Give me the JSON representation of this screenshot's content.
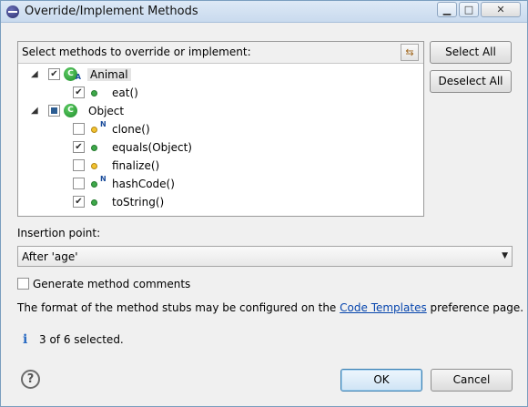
{
  "window": {
    "title": "Override/Implement Methods"
  },
  "panel": {
    "label": "Select methods to override or implement:"
  },
  "tree": {
    "classes": [
      {
        "name": "Animal",
        "state": "checked",
        "abstract": true,
        "selected": true
      },
      {
        "name": "Object",
        "state": "partial",
        "abstract": false,
        "selected": false
      }
    ],
    "methods": [
      {
        "name": "eat()",
        "checked": true,
        "visibility": "public",
        "native": false
      },
      {
        "name": "clone()",
        "checked": false,
        "visibility": "protected",
        "native": true
      },
      {
        "name": "equals(Object)",
        "checked": true,
        "visibility": "public",
        "native": false
      },
      {
        "name": "finalize()",
        "checked": false,
        "visibility": "protected",
        "native": false
      },
      {
        "name": "hashCode()",
        "checked": false,
        "visibility": "public",
        "native": true
      },
      {
        "name": "toString()",
        "checked": true,
        "visibility": "public",
        "native": false
      }
    ],
    "native_marker": "N"
  },
  "buttons": {
    "select_all": "Select All",
    "deselect_all": "Deselect All",
    "ok": "OK",
    "cancel": "Cancel"
  },
  "insertion": {
    "label": "Insertion point:",
    "value": "After 'age'"
  },
  "generate_comments": {
    "label": "Generate method comments",
    "checked": false
  },
  "info": {
    "prefix": "The format of the method stubs may be configured on the",
    "link": "Code Templates",
    "suffix": "preference page."
  },
  "status": {
    "text": "3 of 6 selected."
  },
  "colors": {
    "public_method": "#3ea84a",
    "protected_method": "#f2c230",
    "link": "#0645ad"
  },
  "icons": {
    "app": "eclipse-icon",
    "class": "class-icon",
    "info": "info-icon",
    "help": "help-icon",
    "sort": "sort-icon"
  }
}
